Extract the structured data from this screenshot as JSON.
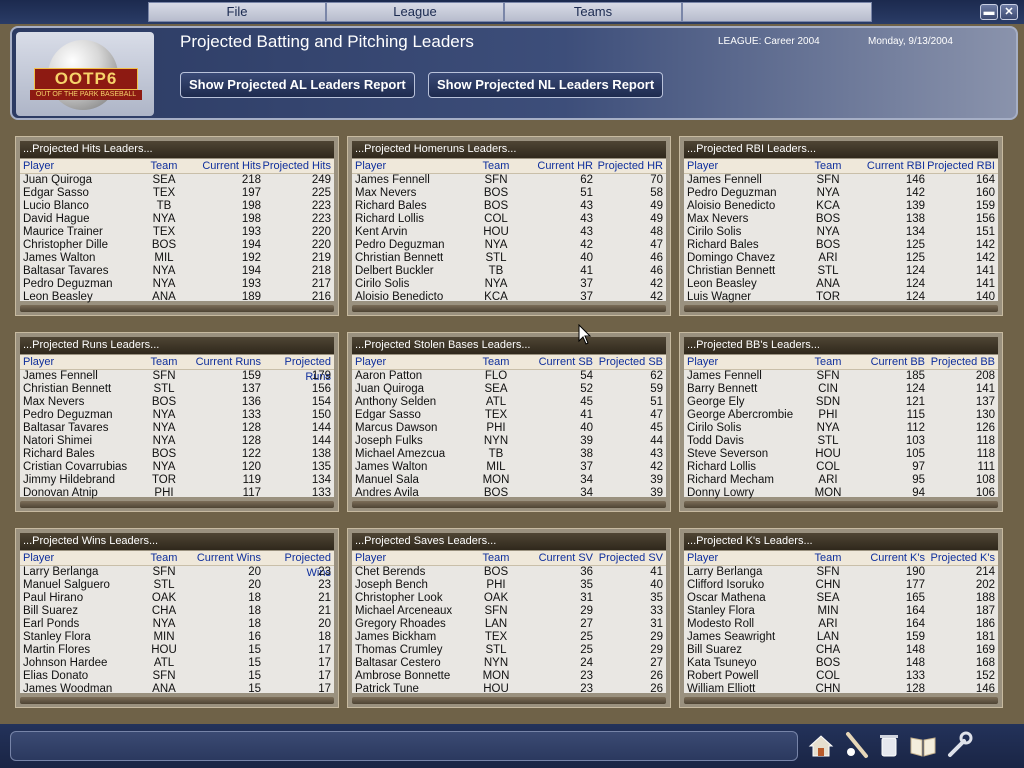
{
  "menu": {
    "file": "File",
    "league": "League",
    "teams": "Teams"
  },
  "window_controls": {
    "minimize": "▬",
    "close": "✕"
  },
  "header": {
    "logo": "OOTP6",
    "logo_sub": "OUT OF THE PARK BASEBALL",
    "title": "Projected Batting and Pitching Leaders",
    "al_button": "Show Projected AL Leaders Report",
    "nl_button": "Show Projected NL Leaders Report",
    "league": "LEAGUE: Career 2004",
    "date": "Monday, 9/13/2004"
  },
  "panels": [
    {
      "title": "...Projected Hits Leaders...",
      "headers": [
        "Player",
        "Team",
        "Current Hits",
        "Projected Hits"
      ],
      "rows": [
        [
          "Juan Quiroga",
          "SEA",
          "218",
          "249"
        ],
        [
          "Edgar Sasso",
          "TEX",
          "197",
          "225"
        ],
        [
          "Lucio Blanco",
          "TB",
          "198",
          "223"
        ],
        [
          "David Hague",
          "NYA",
          "198",
          "223"
        ],
        [
          "Maurice Trainer",
          "TEX",
          "193",
          "220"
        ],
        [
          "Christopher Dille",
          "BOS",
          "194",
          "220"
        ],
        [
          "James Walton",
          "MIL",
          "192",
          "219"
        ],
        [
          "Baltasar Tavares",
          "NYA",
          "194",
          "218"
        ],
        [
          "Pedro Deguzman",
          "NYA",
          "193",
          "217"
        ],
        [
          "Leon Beasley",
          "ANA",
          "189",
          "216"
        ]
      ]
    },
    {
      "title": "...Projected Homeruns Leaders...",
      "headers": [
        "Player",
        "Team",
        "Current HR",
        "Projected HR"
      ],
      "rows": [
        [
          "James Fennell",
          "SFN",
          "62",
          "70"
        ],
        [
          "Max Nevers",
          "BOS",
          "51",
          "58"
        ],
        [
          "Richard Bales",
          "BOS",
          "43",
          "49"
        ],
        [
          "Richard Lollis",
          "COL",
          "43",
          "49"
        ],
        [
          "Kent Arvin",
          "HOU",
          "43",
          "48"
        ],
        [
          "Pedro Deguzman",
          "NYA",
          "42",
          "47"
        ],
        [
          "Christian Bennett",
          "STL",
          "40",
          "46"
        ],
        [
          "Delbert Buckler",
          "TB",
          "41",
          "46"
        ],
        [
          "Cirilo Solis",
          "NYA",
          "37",
          "42"
        ],
        [
          "Aloisio Benedicto",
          "KCA",
          "37",
          "42"
        ]
      ]
    },
    {
      "title": "...Projected RBI Leaders...",
      "headers": [
        "Player",
        "Team",
        "Current RBI",
        "Projected RBI"
      ],
      "rows": [
        [
          "James Fennell",
          "SFN",
          "146",
          "164"
        ],
        [
          "Pedro Deguzman",
          "NYA",
          "142",
          "160"
        ],
        [
          "Aloisio Benedicto",
          "KCA",
          "139",
          "159"
        ],
        [
          "Max Nevers",
          "BOS",
          "138",
          "156"
        ],
        [
          "Cirilo Solis",
          "NYA",
          "134",
          "151"
        ],
        [
          "Richard Bales",
          "BOS",
          "125",
          "142"
        ],
        [
          "Domingo Chavez",
          "ARI",
          "125",
          "142"
        ],
        [
          "Christian Bennett",
          "STL",
          "124",
          "141"
        ],
        [
          "Leon Beasley",
          "ANA",
          "124",
          "141"
        ],
        [
          "Luis Wagner",
          "TOR",
          "124",
          "140"
        ]
      ]
    },
    {
      "title": "...Projected Runs Leaders...",
      "headers": [
        "Player",
        "Team",
        "Current Runs",
        "Projected Runs"
      ],
      "rows": [
        [
          "James Fennell",
          "SFN",
          "159",
          "179"
        ],
        [
          "Christian Bennett",
          "STL",
          "137",
          "156"
        ],
        [
          "Max Nevers",
          "BOS",
          "136",
          "154"
        ],
        [
          "Pedro Deguzman",
          "NYA",
          "133",
          "150"
        ],
        [
          "Baltasar Tavares",
          "NYA",
          "128",
          "144"
        ],
        [
          "Natori Shimei",
          "NYA",
          "128",
          "144"
        ],
        [
          "Richard Bales",
          "BOS",
          "122",
          "138"
        ],
        [
          "Cristian Covarrubias",
          "NYA",
          "120",
          "135"
        ],
        [
          "Jimmy Hildebrand",
          "TOR",
          "119",
          "134"
        ],
        [
          "Donovan Atnip",
          "PHI",
          "117",
          "133"
        ]
      ]
    },
    {
      "title": "...Projected Stolen Bases Leaders...",
      "headers": [
        "Player",
        "Team",
        "Current SB",
        "Projected SB"
      ],
      "rows": [
        [
          "Aaron Patton",
          "FLO",
          "54",
          "62"
        ],
        [
          "Juan Quiroga",
          "SEA",
          "52",
          "59"
        ],
        [
          "Anthony Selden",
          "ATL",
          "45",
          "51"
        ],
        [
          "Edgar Sasso",
          "TEX",
          "41",
          "47"
        ],
        [
          "Marcus Dawson",
          "PHI",
          "40",
          "45"
        ],
        [
          "Joseph Fulks",
          "NYN",
          "39",
          "44"
        ],
        [
          "Michael Amezcua",
          "TB",
          "38",
          "43"
        ],
        [
          "James Walton",
          "MIL",
          "37",
          "42"
        ],
        [
          "Manuel Sala",
          "MON",
          "34",
          "39"
        ],
        [
          "Andres Avila",
          "BOS",
          "34",
          "39"
        ]
      ]
    },
    {
      "title": "...Projected BB's Leaders...",
      "headers": [
        "Player",
        "Team",
        "Current BB",
        "Projected BB"
      ],
      "rows": [
        [
          "James Fennell",
          "SFN",
          "185",
          "208"
        ],
        [
          "Barry Bennett",
          "CIN",
          "124",
          "141"
        ],
        [
          "George Ely",
          "SDN",
          "121",
          "137"
        ],
        [
          "George Abercrombie",
          "PHI",
          "115",
          "130"
        ],
        [
          "Cirilo Solis",
          "NYA",
          "112",
          "126"
        ],
        [
          "Todd Davis",
          "STL",
          "103",
          "118"
        ],
        [
          "Steve Severson",
          "HOU",
          "105",
          "118"
        ],
        [
          "Richard Lollis",
          "COL",
          "97",
          "111"
        ],
        [
          "Richard Mecham",
          "ARI",
          "95",
          "108"
        ],
        [
          "Donny Lowry",
          "MON",
          "94",
          "106"
        ]
      ]
    },
    {
      "title": "...Projected Wins Leaders...",
      "headers": [
        "Player",
        "Team",
        "Current Wins",
        "Projected Wins"
      ],
      "rows": [
        [
          "Larry Berlanga",
          "SFN",
          "20",
          "23"
        ],
        [
          "Manuel Salguero",
          "STL",
          "20",
          "23"
        ],
        [
          "Paul Hirano",
          "OAK",
          "18",
          "21"
        ],
        [
          "Bill Suarez",
          "CHA",
          "18",
          "21"
        ],
        [
          "Earl Ponds",
          "NYA",
          "18",
          "20"
        ],
        [
          "Stanley Flora",
          "MIN",
          "16",
          "18"
        ],
        [
          "Martin Flores",
          "HOU",
          "15",
          "17"
        ],
        [
          "Johnson Hardee",
          "ATL",
          "15",
          "17"
        ],
        [
          "Elias Donato",
          "SFN",
          "15",
          "17"
        ],
        [
          "James Woodman",
          "ANA",
          "15",
          "17"
        ]
      ]
    },
    {
      "title": "...Projected Saves Leaders...",
      "headers": [
        "Player",
        "Team",
        "Current SV",
        "Projected SV"
      ],
      "rows": [
        [
          "Chet Berends",
          "BOS",
          "36",
          "41"
        ],
        [
          "Joseph Bench",
          "PHI",
          "35",
          "40"
        ],
        [
          "Christopher Look",
          "OAK",
          "31",
          "35"
        ],
        [
          "Michael Arceneaux",
          "SFN",
          "29",
          "33"
        ],
        [
          "Gregory Rhoades",
          "LAN",
          "27",
          "31"
        ],
        [
          "James Bickham",
          "TEX",
          "25",
          "29"
        ],
        [
          "Thomas Crumley",
          "STL",
          "25",
          "29"
        ],
        [
          "Baltasar Cestero",
          "NYN",
          "24",
          "27"
        ],
        [
          "Ambrose Bonnette",
          "MON",
          "23",
          "26"
        ],
        [
          "Patrick Tune",
          "HOU",
          "23",
          "26"
        ]
      ]
    },
    {
      "title": "...Projected K's Leaders...",
      "headers": [
        "Player",
        "Team",
        "Current K's",
        "Projected K's"
      ],
      "rows": [
        [
          "Larry Berlanga",
          "SFN",
          "190",
          "214"
        ],
        [
          "Clifford Isoruko",
          "CHN",
          "177",
          "202"
        ],
        [
          "Oscar Mathena",
          "SEA",
          "165",
          "188"
        ],
        [
          "Stanley Flora",
          "MIN",
          "164",
          "187"
        ],
        [
          "Modesto Roll",
          "ARI",
          "164",
          "186"
        ],
        [
          "James Seawright",
          "LAN",
          "159",
          "181"
        ],
        [
          "Bill Suarez",
          "CHA",
          "148",
          "169"
        ],
        [
          "Kata Tsuneyo",
          "BOS",
          "148",
          "168"
        ],
        [
          "Robert Powell",
          "COL",
          "133",
          "152"
        ],
        [
          "William Elliott",
          "CHN",
          "128",
          "146"
        ]
      ]
    }
  ],
  "bottom_icons": [
    "home-icon",
    "bat-icon",
    "trash-icon",
    "book-icon",
    "wrench-icon"
  ]
}
